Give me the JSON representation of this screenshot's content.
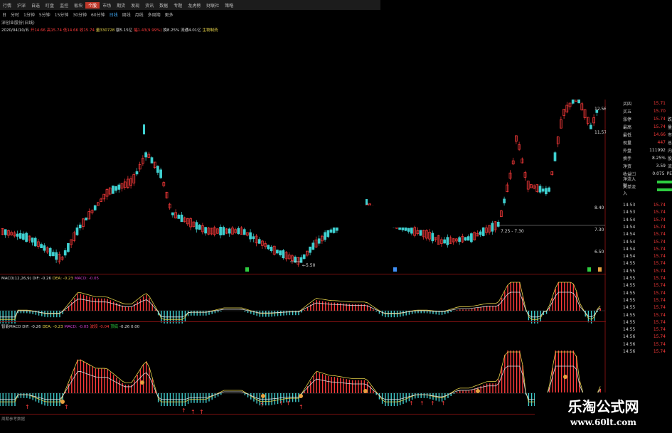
{
  "menu": [
    "行情",
    "沪深",
    "自选",
    "盯盘",
    "监控",
    "板块",
    "个股",
    "市场",
    "期货",
    "发现",
    "资讯",
    "数据",
    "专题",
    "龙虎榜",
    "财联社",
    "策略"
  ],
  "menu_active_index": 6,
  "periods": [
    "日",
    "分时",
    "1分钟",
    "5分钟",
    "15分钟",
    "30分钟",
    "60分钟",
    "日线",
    "周线",
    "月线",
    "多周期",
    "更多"
  ],
  "period_active_index": 7,
  "title": "深创业股份(日线)",
  "info": {
    "date": "2020/04/10/五",
    "open": "开14.66",
    "high": "高15.74",
    "low": "低14.66",
    "close": "收15.74",
    "volume": "量330728",
    "amount": "额5.15亿",
    "change": "幅1.43(9.99%)",
    "turnover": "换8.25%",
    "float": "流通4.01亿",
    "sector": "生物制药"
  },
  "right_panel": {
    "rows": [
      {
        "label": "买四",
        "value": "15.71",
        "extra": ""
      },
      {
        "label": "买五",
        "value": "15.70",
        "extra": ""
      },
      {
        "label": "涨停",
        "value": "15.74",
        "extra": "跌"
      },
      {
        "label": "最高",
        "value": "15.74",
        "extra": "量"
      },
      {
        "label": "最低",
        "value": "14.66",
        "extra": "市"
      },
      {
        "label": "现量",
        "value": "447",
        "extra": "总"
      },
      {
        "label": "外盘",
        "value": "111992",
        "extra": "内"
      },
      {
        "label": "换手",
        "value": "8.25%",
        "extra": "股"
      },
      {
        "label": "净资",
        "value": "3.59",
        "extra": "流"
      },
      {
        "label": "收益㈢",
        "value": "0.075",
        "extra": "PE"
      },
      {
        "label": "净流入额",
        "value": "",
        "extra": ""
      },
      {
        "label": "大单流入",
        "value": "",
        "extra": ""
      }
    ],
    "ticks": [
      {
        "time": "14:53",
        "price": "15.74"
      },
      {
        "time": "14:53",
        "price": "15.74"
      },
      {
        "time": "14:54",
        "price": "15.74"
      },
      {
        "time": "14:54",
        "price": "15.74"
      },
      {
        "time": "14:54",
        "price": "15.74"
      },
      {
        "time": "14:54",
        "price": "15.74"
      },
      {
        "time": "14:54",
        "price": "15.74"
      },
      {
        "time": "14:54",
        "price": "15.74"
      },
      {
        "time": "14:55",
        "price": "15.74"
      },
      {
        "time": "14:55",
        "price": "15.74"
      },
      {
        "time": "14:55",
        "price": "15.74"
      },
      {
        "time": "14:55",
        "price": "15.74"
      },
      {
        "time": "14:55",
        "price": "15.74"
      },
      {
        "time": "14:55",
        "price": "15.74"
      },
      {
        "time": "14:55",
        "price": "15.74"
      },
      {
        "time": "14:55",
        "price": "15.74"
      },
      {
        "time": "14:55",
        "price": "15.74"
      },
      {
        "time": "14:55",
        "price": "15.74"
      },
      {
        "time": "14:56",
        "price": "15.74"
      },
      {
        "time": "14:56",
        "price": "15.74"
      },
      {
        "time": "14:56",
        "price": "15.74"
      }
    ]
  },
  "price_axis": [
    "12.56",
    "11.57",
    "8.40",
    "7.30",
    "6.50"
  ],
  "annotations": {
    "low_label": "←5.50",
    "range_label": "7.25 - 7.30"
  },
  "macd": {
    "name": "MACD(12,26,9)",
    "dif": "DIF: -0.26",
    "dea": "DEA: -0.23",
    "macd": "MACD: -0.05"
  },
  "smart_macd": {
    "name": "智能MACD",
    "dif": "DIF: -0.26",
    "dea": "DEA: -0.23",
    "macd": "MACD: -0.05",
    "extra1": "波段",
    "extra2": "-0.04",
    "extra3": "顶底",
    "extra4": "-0.26",
    "extra5": "0.00"
  },
  "footer": "周期参考数据",
  "watermark": {
    "line1": "乐淘公式网",
    "line2": "www.60lt.com"
  },
  "colors": {
    "up": "#ff3b3b",
    "down": "#3fd0d0",
    "dif": "#e6d24a",
    "dea": "#dddddd",
    "active": "#c0392b"
  }
}
